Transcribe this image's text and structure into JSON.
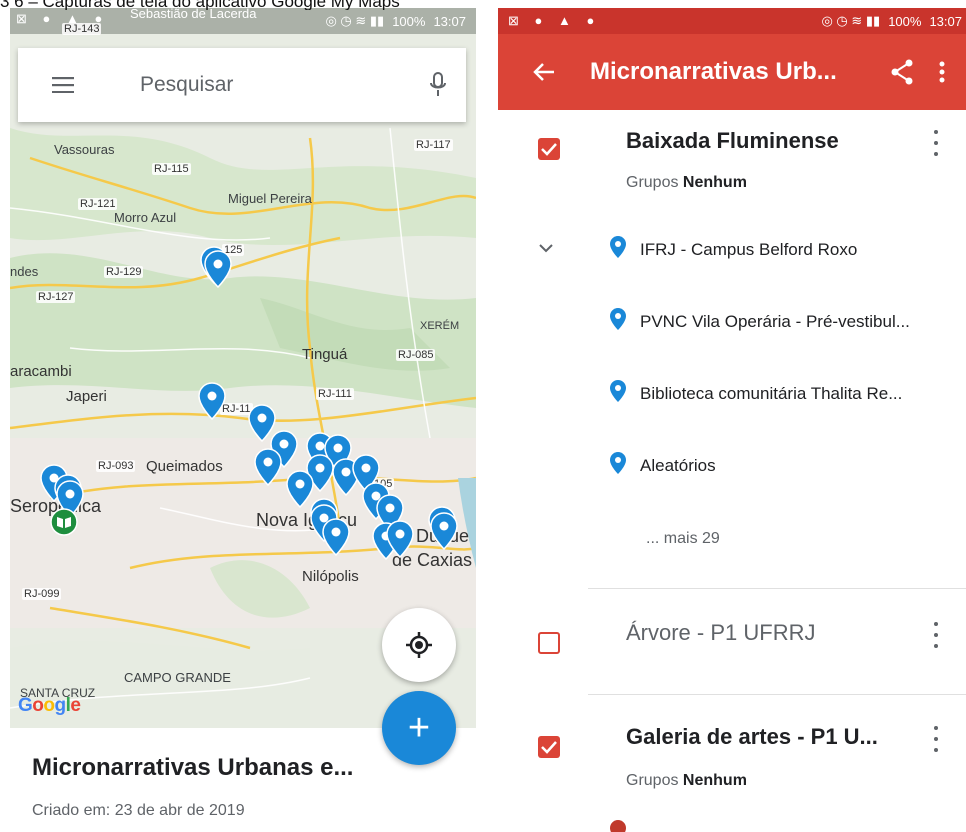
{
  "caption": "3 6 – Capturas de tela do aplicativo Google My Maps",
  "left": {
    "status": {
      "battery": "100%",
      "time": "13:07",
      "place": "Sebastião de Lacerda"
    },
    "search": {
      "placeholder": "Pesquisar"
    },
    "map_labels": {
      "vassouras": "Vassouras",
      "rj115": "RJ-115",
      "miguel_pereira": "Miguel Pereira",
      "rj121": "RJ-121",
      "morro_azul": "Morro Azul",
      "rj125": "125",
      "rj129": "RJ-129",
      "ndes": "ndes",
      "rj127": "RJ-127",
      "rj117": "RJ-117",
      "xerem": "XERÉM",
      "tingua": "Tinguá",
      "rj085": "RJ-085",
      "aracambi": "aracambi",
      "japeri": "Japeri",
      "rj11": "RJ-11",
      "rj111": "RJ-111",
      "rj093": "RJ-093",
      "queimados": "Queimados",
      "nova_iguacu": "Nova Iguaçu",
      "rj105": "105",
      "seropedica": "Seropédica",
      "duque": "Duque",
      "de_caxias": "de Caxias",
      "nilopolis": "Nilópolis",
      "rj099": "RJ-099",
      "campo_grande": "CAMPO GRANDE",
      "santa_cruz": "SANTA CRUZ",
      "rj143": "RJ-143"
    },
    "google": "Google",
    "map_title": "Micronarrativas Urbanas e...",
    "created": "Criado em: 23 de abr de 2019",
    "fab_add": "+"
  },
  "right": {
    "status": {
      "battery": "100%",
      "time": "13:07"
    },
    "appbar": {
      "title": "Micronarrativas Urb..."
    },
    "layers": [
      {
        "name": "Baixada Fluminense",
        "checked": true,
        "groups_label": "Grupos",
        "groups_value": "Nenhum"
      },
      {
        "name": "Árvore - P1 UFRRJ",
        "checked": false
      },
      {
        "name": "Galeria de artes - P1 U...",
        "checked": true,
        "groups_label": "Grupos",
        "groups_value": "Nenhum"
      }
    ],
    "places": [
      "IFRJ - Campus Belford Roxo",
      "PVNC Vila Operária - Pré-vestibul...",
      "Biblioteca comunitária Thalita Re...",
      "Aleatórios"
    ],
    "more_text": "... mais 29"
  },
  "colors": {
    "accent_red": "#db4437",
    "pin_blue": "#1a88d8",
    "pin_green": "#1e8e3e"
  }
}
